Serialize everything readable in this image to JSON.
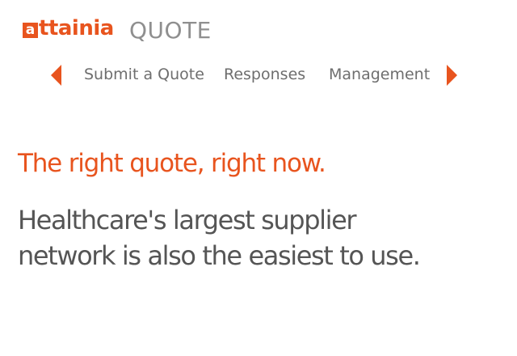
{
  "brand": {
    "logo_mark": "a",
    "logo_text": "ttainia",
    "product": "QUOTE",
    "accent_color": "#e8541e"
  },
  "nav": {
    "prev_icon": "triangle-left-icon",
    "next_icon": "triangle-right-icon",
    "items": [
      {
        "label": "Submit a Quote"
      },
      {
        "label": "Responses"
      },
      {
        "label": "Management"
      }
    ]
  },
  "hero": {
    "headline": "The right quote, right now.",
    "tagline_line1": "Healthcare's largest supplier",
    "tagline_line2": "network is also the easiest to use."
  }
}
